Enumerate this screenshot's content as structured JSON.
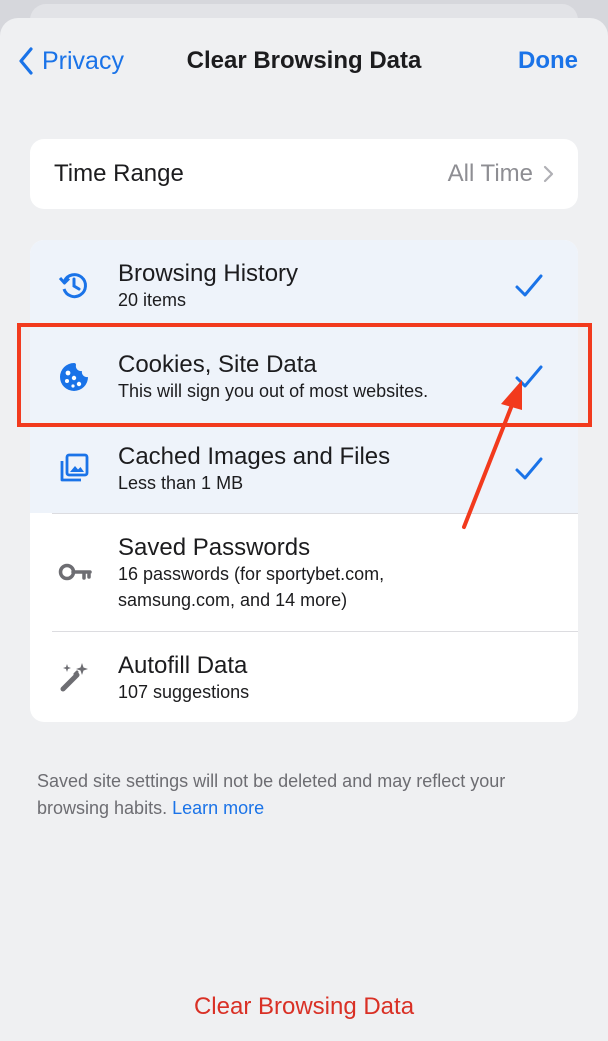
{
  "nav": {
    "back_label": "Privacy",
    "title": "Clear Browsing Data",
    "done_label": "Done"
  },
  "time_range": {
    "label": "Time Range",
    "value": "All Time"
  },
  "items": [
    {
      "title": "Browsing History",
      "subtitle": "20 items",
      "icon": "history-icon",
      "checked": true
    },
    {
      "title": "Cookies, Site Data",
      "subtitle": "This will sign you out of most websites.",
      "icon": "cookie-icon",
      "checked": true
    },
    {
      "title": "Cached Images and Files",
      "subtitle": "Less than 1 MB",
      "icon": "image-icon",
      "checked": true
    },
    {
      "title": "Saved Passwords",
      "subtitle_line1": "16 passwords (for sportybet.com,",
      "subtitle_line2": "samsung.com, and 14 more)",
      "icon": "key-icon",
      "checked": false
    },
    {
      "title": "Autofill Data",
      "subtitle": "107 suggestions",
      "icon": "magic-wand-icon",
      "checked": false
    }
  ],
  "footnote": {
    "text": "Saved site settings will not be deleted and may reflect your browsing habits.",
    "link": "Learn more"
  },
  "clear_button": "Clear Browsing Data",
  "colors": {
    "accent": "#1a73e8",
    "destructive": "#d93025",
    "annotation": "#f23a1d",
    "background": "#eff0f2"
  }
}
